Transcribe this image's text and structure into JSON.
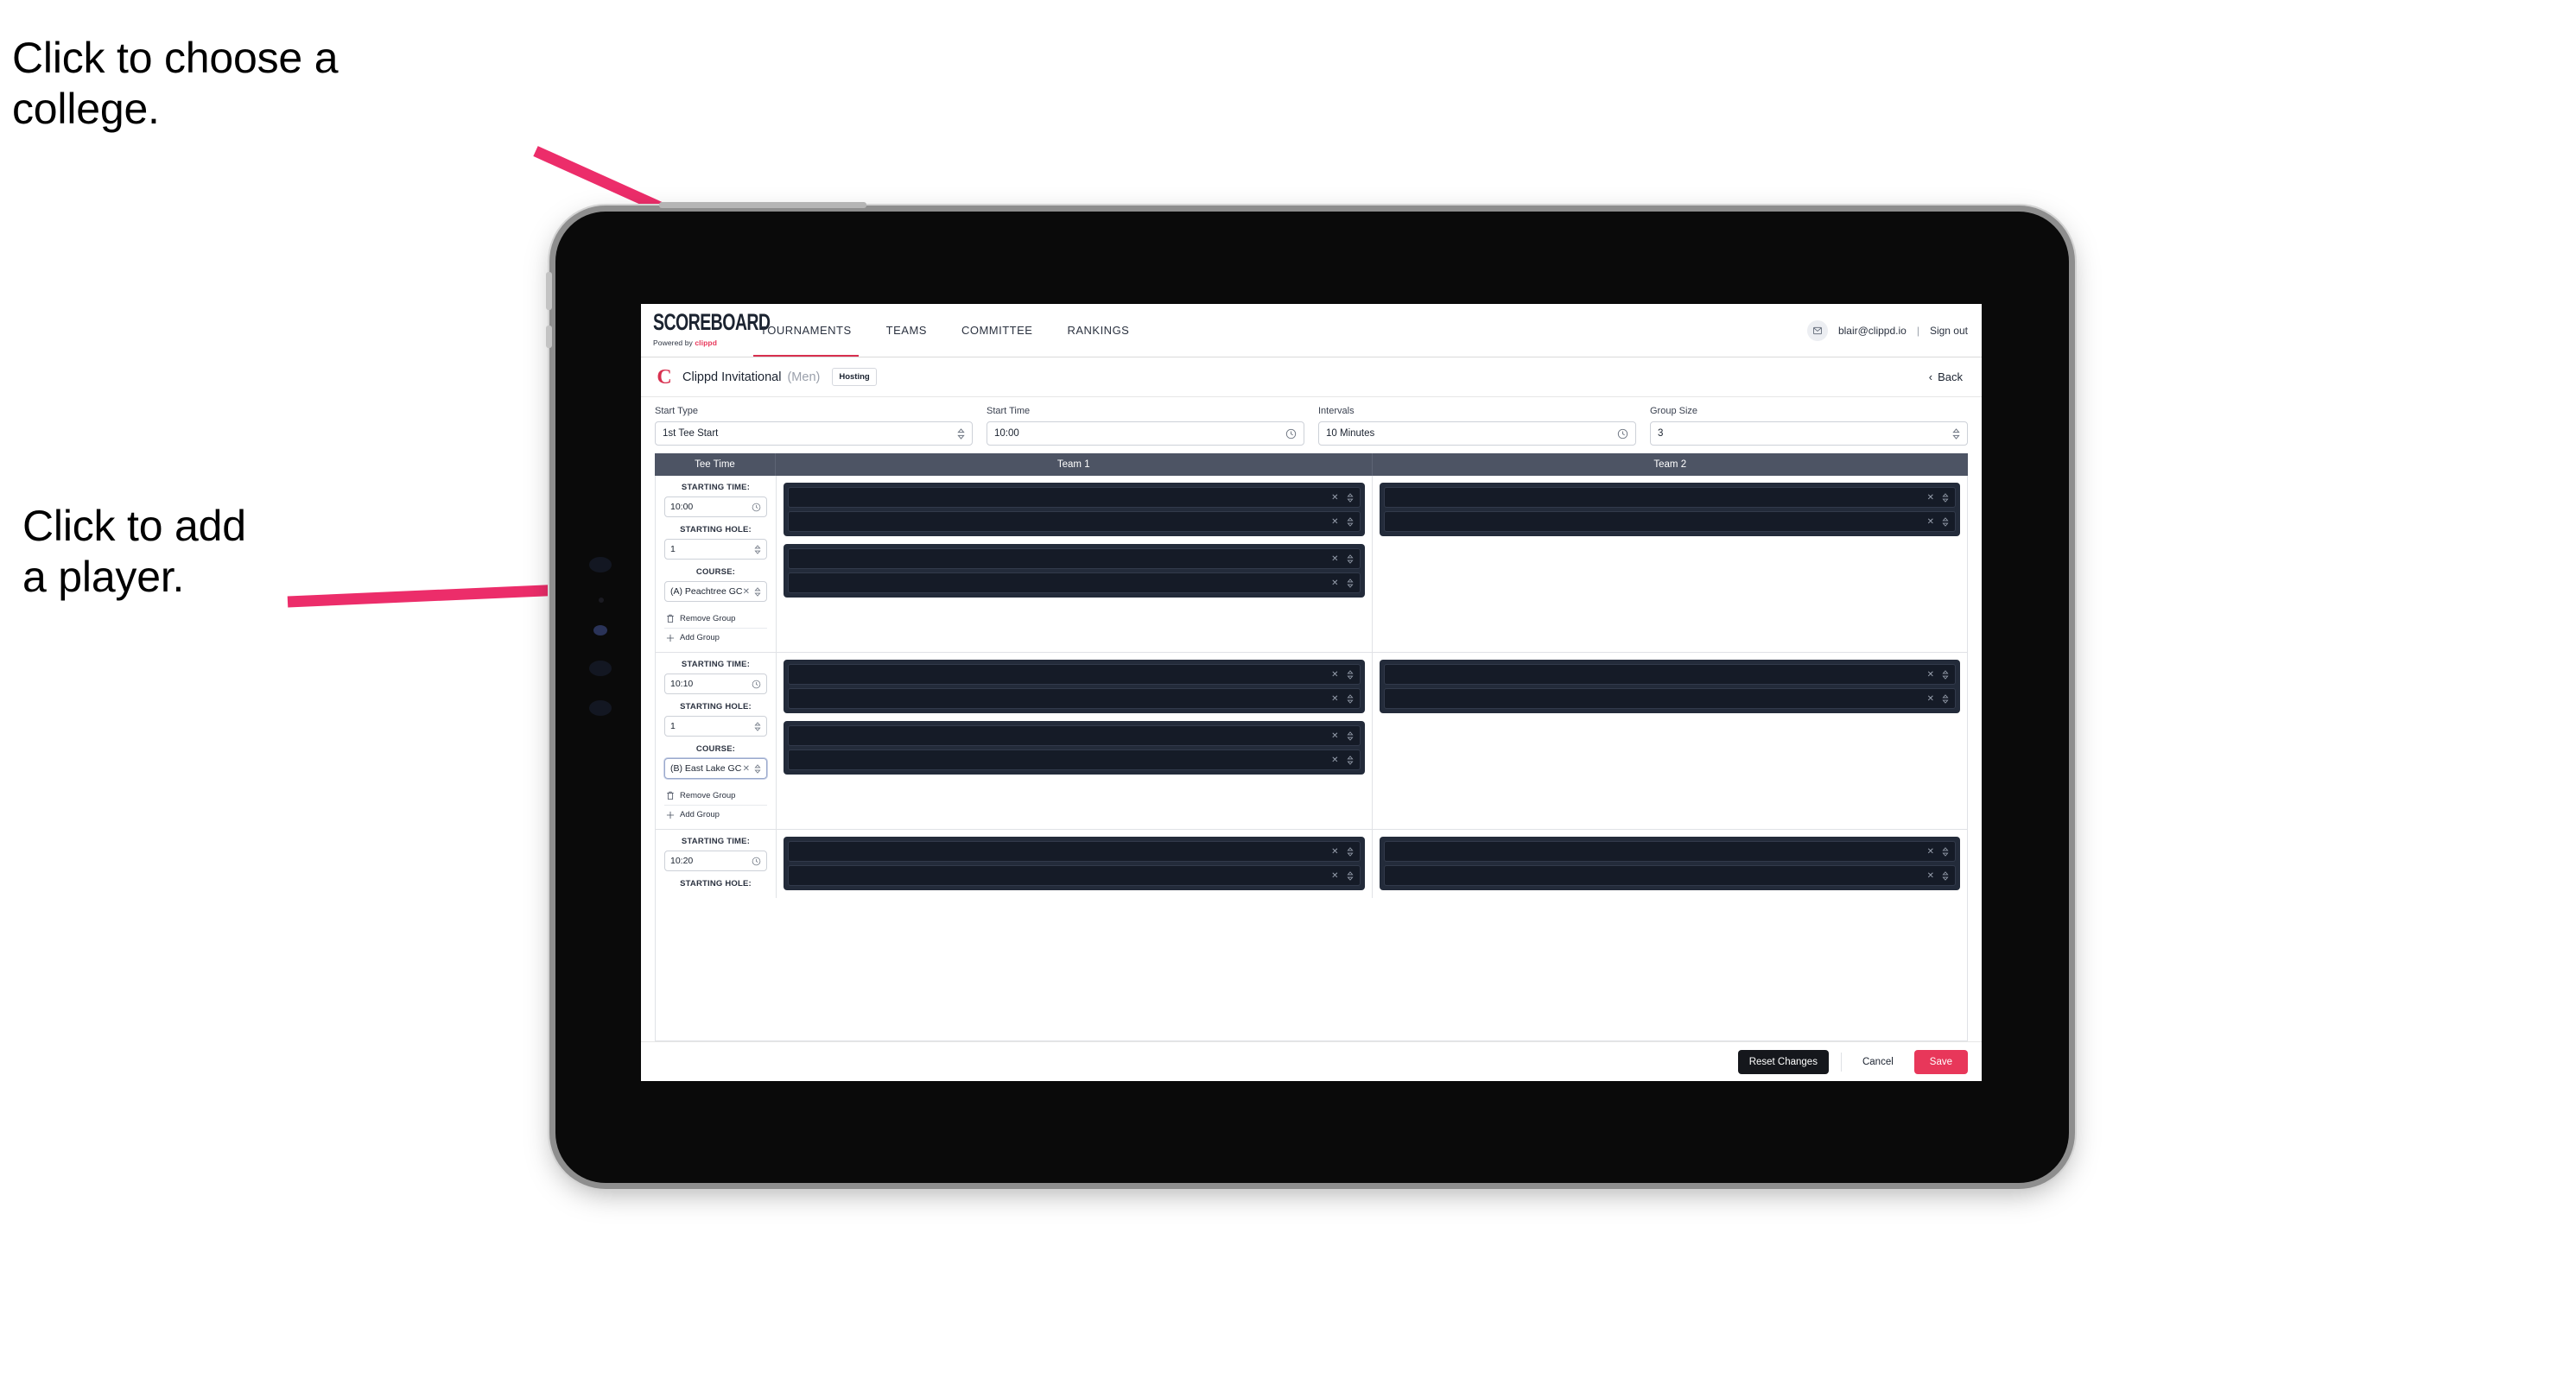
{
  "annotations": {
    "choose_college": "Click to choose a\ncollege.",
    "add_player": "Click to add\na player."
  },
  "colors": {
    "accent_pink": "#e8375a",
    "arrow_pink": "#ec2d6a",
    "nav_underline": "#d8304f",
    "table_header_bg": "#4d5464",
    "player_panel_bg": "#232b3a",
    "player_row_bg": "#151b27",
    "reset_button_bg": "#15171c"
  },
  "nav": {
    "brand_word": "SCOREBOARD",
    "brand_sub_prefix": "Powered by ",
    "brand_sub_name": "clippd",
    "tabs": [
      {
        "label": "TOURNAMENTS",
        "active": true
      },
      {
        "label": "TEAMS",
        "active": false
      },
      {
        "label": "COMMITTEE",
        "active": false
      },
      {
        "label": "RANKINGS",
        "active": false
      }
    ],
    "avatar_glyph": "✉",
    "user_email": "blair@clippd.io",
    "separator": "|",
    "sign_out": "Sign out"
  },
  "titlebar": {
    "logo_letter": "C",
    "tournament_name": "Clippd Invitational",
    "gender": "(Men)",
    "hosting_badge": "Hosting",
    "back_label": "Back",
    "back_chevron": "‹"
  },
  "filters": [
    {
      "label": "Start Type",
      "value": "1st Tee Start",
      "icon": "stepper-icon"
    },
    {
      "label": "Start Time",
      "value": "10:00",
      "icon": "clock-icon"
    },
    {
      "label": "Intervals",
      "value": "10 Minutes",
      "icon": "clock-icon"
    },
    {
      "label": "Group Size",
      "value": "3",
      "icon": "stepper-icon"
    }
  ],
  "table": {
    "columns": [
      {
        "key": "tee",
        "label": "Tee Time"
      },
      {
        "key": "team1",
        "label": "Team 1"
      },
      {
        "key": "team2",
        "label": "Team 2"
      }
    ],
    "labels": {
      "starting_time": "STARTING TIME:",
      "starting_hole": "STARTING HOLE:",
      "course": "COURSE:",
      "remove_group": "Remove Group",
      "add_group": "Add Group",
      "clear_icon": "✕"
    },
    "rows": [
      {
        "starting_time": "10:00",
        "starting_hole": "1",
        "course": "(A) Peachtree GC",
        "course_focused": false,
        "team1_panels": [
          {
            "players": [
              "",
              ""
            ]
          },
          {
            "players": [
              "",
              ""
            ]
          }
        ],
        "team2_panels": [
          {
            "players": [
              "",
              ""
            ]
          }
        ]
      },
      {
        "starting_time": "10:10",
        "starting_hole": "1",
        "course": "(B) East Lake GC",
        "course_focused": true,
        "team1_panels": [
          {
            "players": [
              "",
              ""
            ]
          },
          {
            "players": [
              "",
              ""
            ]
          }
        ],
        "team2_panels": [
          {
            "players": [
              "",
              ""
            ]
          }
        ]
      },
      {
        "starting_time": "10:20",
        "starting_hole": "",
        "course": "",
        "course_focused": false,
        "team1_panels": [
          {
            "players": [
              "",
              ""
            ]
          }
        ],
        "team2_panels": [
          {
            "players": [
              "",
              ""
            ]
          }
        ]
      }
    ]
  },
  "footer": {
    "reset": "Reset Changes",
    "cancel": "Cancel",
    "save": "Save"
  }
}
